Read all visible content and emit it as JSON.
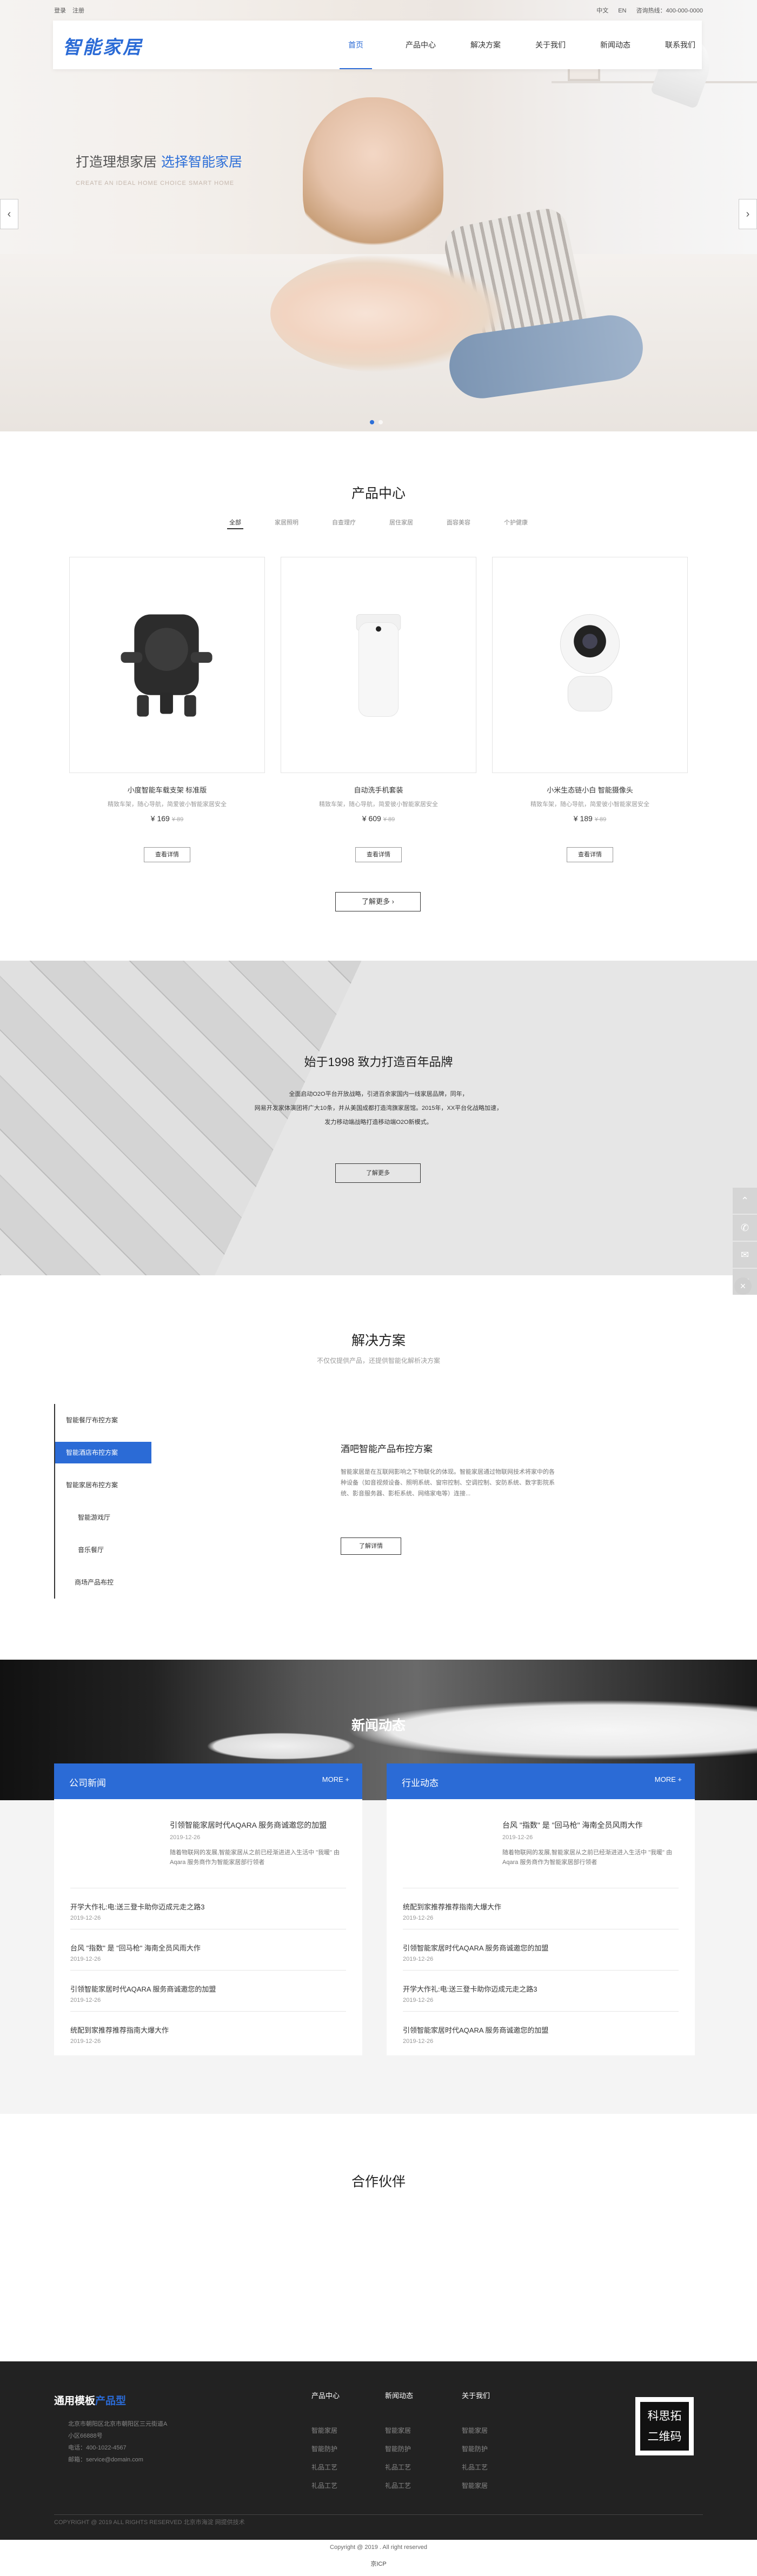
{
  "topbar": {
    "login": "登录",
    "register": "注册",
    "lang_cn": "中文",
    "lang_en": "EN",
    "hotline": "咨询热线：400-000-0000"
  },
  "brand": {
    "logo": "智能家居",
    "accent": "#2b6bd6"
  },
  "nav": {
    "items": [
      "首页",
      "产品中心",
      "解决方案",
      "关于我们",
      "新闻动态",
      "联系我们"
    ]
  },
  "hero": {
    "headline": "打造理想家居",
    "headline_highlight": "选择智能家居",
    "subline": "CREATE AN IDEAL HOME CHOICE SMART HOME"
  },
  "products": {
    "title": "产品中心",
    "tabs": [
      "全部",
      "家居照明",
      "自查理疗",
      "居住家居",
      "面容美容",
      "个护健康"
    ],
    "more": "了解更多",
    "items": [
      {
        "name": "小度智能车载支架 标准版",
        "desc": "精致车架，随心导航，简爱彼小智能家居安全",
        "price": "¥ 169",
        "old": "¥ 89",
        "button": "查看详情"
      },
      {
        "name": "自动洗手机套装",
        "desc": "精致车架，随心导航，简爱彼小智能家居安全",
        "price": "¥ 609",
        "old": "¥ 89",
        "button": "查看详情"
      },
      {
        "name": "小米生态链小白 智能摄像头",
        "desc": "精致车架，随心导航，简爱彼小智能家居安全",
        "price": "¥ 189",
        "old": "¥ 89",
        "button": "查看详情"
      }
    ]
  },
  "about": {
    "title": "始于1998 致力打造百年品牌",
    "lines": [
      "全面启动O2O平台开放战略，引进百余家国内一线家居品牌，同年，",
      "网易开发家体演团将广大10条，并从美国成都打造湾旗家居馆。2015年，XX平台化战略加速，",
      "发力移动端战略打造移动端O2O新模式。"
    ],
    "button": "了解更多"
  },
  "solutions": {
    "title": "解决方案",
    "subtitle": "不仅仅提供产品，还提供智能化解析决方案",
    "items": [
      "智能餐厅布控方案",
      "智能酒店布控方案",
      "智能家居布控方案",
      "智能游戏厅",
      "音乐餐厅",
      "商场产品布控"
    ],
    "active_title": "酒吧智能产品布控方案",
    "active_desc": "智能家居是在互联网影响之下物联化的体现。智能家居通过物联网技术将家中的各种设备（如音视频设备、照明系统、窗帘控制、空调控制、安防系统、数字影院系统、影音服务器、影柜系统、网络家电等）连接...",
    "button": "了解详情"
  },
  "news": {
    "title": "新闻动态",
    "company": {
      "label": "公司新闻",
      "more": "MORE +",
      "first": {
        "title": "引领智能家居时代AQARA 服务商诚邀您的加盟",
        "date": "2019-12-26",
        "summary": "随着物联网的发展,智能家居从之前已经渐进进入生活中 \"我暖\" 由 Aqara 服务商作为智能家居部行领者"
      },
      "rows": [
        {
          "t": "开学大作礼:电:送三登卡助你迈成元走之路3",
          "d": "2019-12-26"
        },
        {
          "t": "台风 \"指数\" 是 \"回马枪\" 海南全员风雨大作",
          "d": "2019-12-26"
        },
        {
          "t": "引领智能家居时代AQARA 服务商诚邀您的加盟",
          "d": "2019-12-26"
        },
        {
          "t": "统配到家推荐推荐指南大爆大作",
          "d": "2019-12-26"
        }
      ]
    },
    "industry": {
      "label": "行业动态",
      "more": "MORE +",
      "first": {
        "title": "台风 \"指数\" 是 \"回马枪\" 海南全员风雨大作",
        "date": "2019-12-26",
        "summary": "随着物联网的发展,智能家居从之前已经渐进进入生活中 \"我暖\" 由 Aqara 服务商作为智能家居部行领者"
      },
      "rows": [
        {
          "t": "统配到家推荐推荐指南大爆大作",
          "d": "2019-12-26"
        },
        {
          "t": "引领智能家居时代AQARA 服务商诚邀您的加盟",
          "d": "2019-12-26"
        },
        {
          "t": "开学大作礼:电:送三登卡助你迈成元走之路3",
          "d": "2019-12-26"
        },
        {
          "t": "引领智能家居时代AQARA 服务商诚邀您的加盟",
          "d": "2019-12-26"
        }
      ]
    }
  },
  "partners": {
    "title": "合作伙伴"
  },
  "footer": {
    "logo_a": "通用模板",
    "logo_b": "产品型",
    "info": [
      "北京市朝阳区北京市朝阳区三元街道A",
      "小区66888号",
      "电话：400-1022-4567",
      "邮箱：service@domain.com"
    ],
    "col1": {
      "h": "产品中心",
      "items": [
        "智能家居",
        "智能防护",
        "礼品工艺",
        "礼品工艺"
      ]
    },
    "col2": {
      "h": "新闻动态",
      "items": [
        "智能家居",
        "智能防护",
        "礼品工艺",
        "礼品工艺"
      ]
    },
    "col3": {
      "h": "关于我们",
      "items": [
        "智能家居",
        "智能防护",
        "礼品工艺",
        "智能家居"
      ]
    },
    "qr": [
      "科思拓",
      "二维码"
    ],
    "rights": "COPYRIGHT @ 2019 ALL RIGHTS RESERVED   北京市海淀 网提供技术",
    "copyright": "Copyright @ 2019 . All right reserved",
    "icp": "京ICP"
  }
}
